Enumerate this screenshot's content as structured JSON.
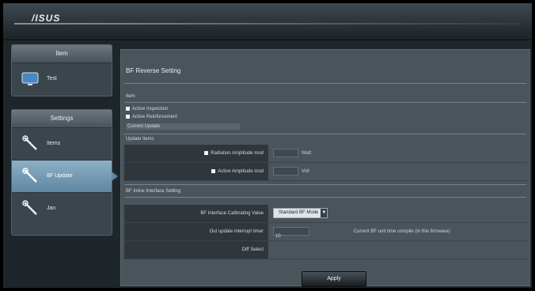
{
  "banner": {
    "logo": "/ISUS"
  },
  "sidebar": {
    "panel1": {
      "header": "Item",
      "items": [
        {
          "label": "Test",
          "icon": "monitor-icon"
        }
      ]
    },
    "panel2": {
      "header": "Settings",
      "items": [
        {
          "label": "Items",
          "icon": "wrench-icon",
          "active": false
        },
        {
          "label": "8F Update",
          "icon": "wrench-icon",
          "active": true
        },
        {
          "label": "Jan",
          "icon": "wrench-icon",
          "active": false
        }
      ]
    }
  },
  "main": {
    "title": "BF Reverse Setting",
    "line1": "Item",
    "check1": "Active Inspection",
    "check2": "Active Reinforcement",
    "line2": "Current Update",
    "section1": "Update Items",
    "rows1": [
      {
        "label": "Radiation Amplitude mod",
        "unit": "Watt"
      },
      {
        "label": "Active Amplitude mod",
        "unit": "Volt"
      }
    ],
    "section2": "BF Inline Interface Setting",
    "rows2": [
      {
        "label": "BF Interface Calibrating Value",
        "select": "Standard BF Mode"
      },
      {
        "label": "Out update interrupt timer",
        "value": "10",
        "note": "Current BF unit time compile (in this firmware)"
      },
      {
        "label": "Diff Select"
      }
    ],
    "apply": "Apply"
  },
  "colors": {
    "accent": "#5f86a1",
    "panel": "#4a545b",
    "label_bg": "#2f373c"
  }
}
